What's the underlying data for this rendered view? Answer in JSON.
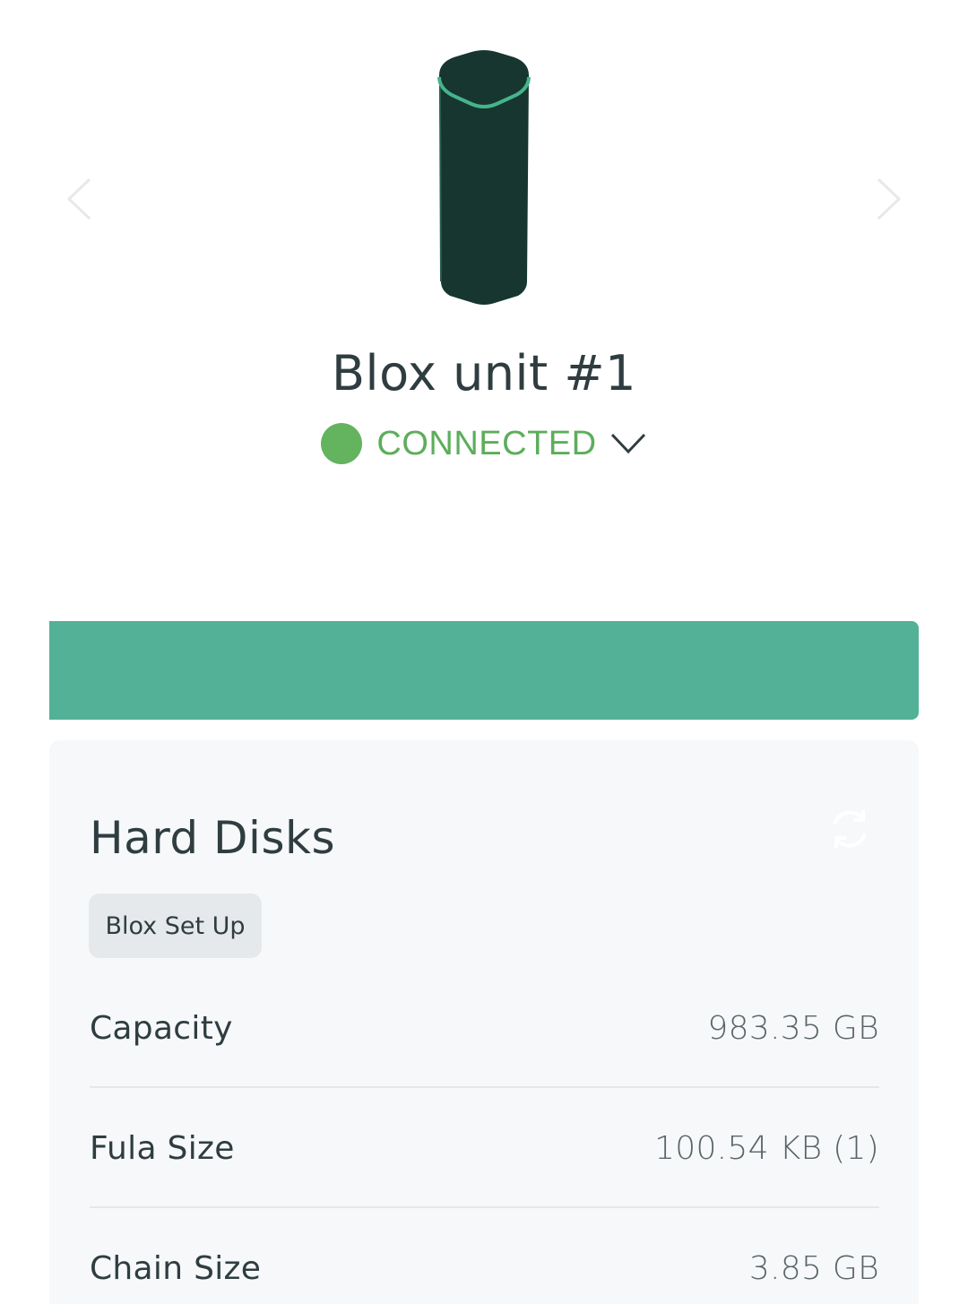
{
  "device": {
    "name": "Blox unit #1",
    "status": "CONNECTED",
    "status_color": "#63b35f"
  },
  "accent_color": "#52b196",
  "hard_disks": {
    "title": "Hard Disks",
    "setup_button": "Blox Set Up",
    "rows": [
      {
        "label": "Capacity",
        "value": "983.35 GB"
      },
      {
        "label": "Fula Size",
        "value": "100.54 KB (1)"
      },
      {
        "label": "Chain Size",
        "value": "3.85 GB"
      }
    ]
  },
  "icons": {
    "prev": "chevron-left-icon",
    "next": "chevron-right-icon",
    "status_dropdown": "chevron-down-icon",
    "refresh": "refresh-icon",
    "device": "blox-device-icon"
  }
}
